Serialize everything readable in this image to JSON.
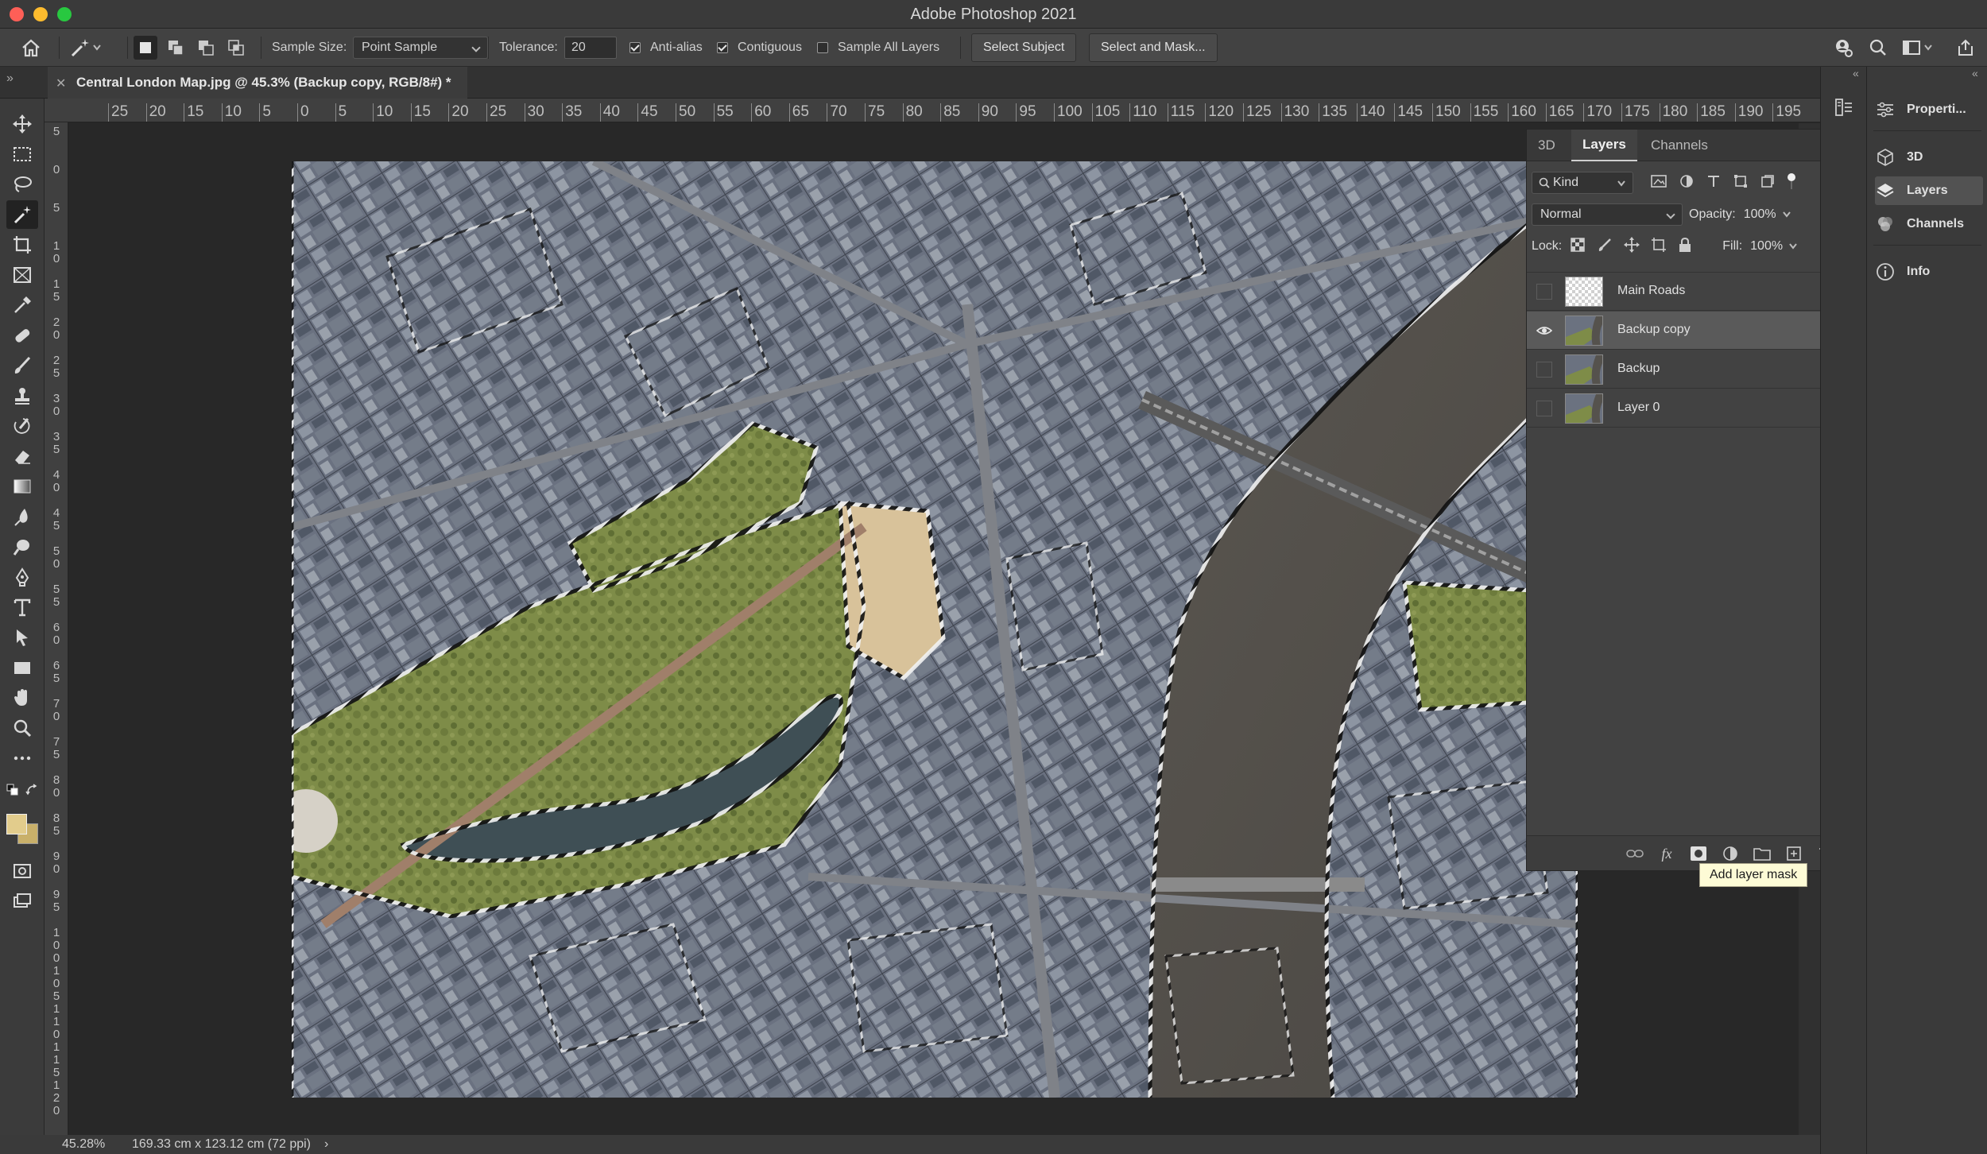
{
  "app": {
    "title": "Adobe Photoshop 2021"
  },
  "options_bar": {
    "sample_size_label": "Sample Size:",
    "sample_size_value": "Point Sample",
    "tolerance_label": "Tolerance:",
    "tolerance_value": "20",
    "anti_alias_label": "Anti-alias",
    "anti_alias_checked": true,
    "contiguous_label": "Contiguous",
    "contiguous_checked": true,
    "sample_all_layers_label": "Sample All Layers",
    "sample_all_layers_checked": false,
    "select_subject_label": "Select Subject",
    "select_and_mask_label": "Select and Mask..."
  },
  "document": {
    "tab_title": "Central London Map.jpg @ 45.3% (Backup copy, RGB/8#) *"
  },
  "rulers": {
    "horizontal_ticks": [
      "25",
      "20",
      "15",
      "10",
      "5",
      "0",
      "5",
      "10",
      "15",
      "20",
      "25",
      "30",
      "35",
      "40",
      "45",
      "50",
      "55",
      "60",
      "65",
      "70",
      "75",
      "80",
      "85",
      "90",
      "95",
      "100",
      "105",
      "110",
      "115",
      "120",
      "125",
      "130",
      "135",
      "140",
      "145",
      "150",
      "155",
      "160",
      "165",
      "170",
      "175",
      "180",
      "185",
      "190",
      "195"
    ],
    "vertical_ticks": [
      "5",
      "0",
      "5",
      "1 0",
      "1 5",
      "2 0",
      "2 5",
      "3 0",
      "3 5",
      "4 0",
      "4 5",
      "5 0",
      "5 5",
      "6 0",
      "6 5",
      "7 0",
      "7 5",
      "8 0",
      "8 5",
      "9 0",
      "9 5",
      "1 0 0",
      "1 0 5",
      "1 1 0",
      "1 1 5",
      "1 2 0"
    ]
  },
  "status_bar": {
    "zoom": "45.28%",
    "doc_size": "169.33 cm x 123.12 cm (72 ppi)",
    "arrow": "›"
  },
  "right_dock": {
    "items": [
      {
        "label": "Properti...",
        "icon": "properties-icon"
      },
      {
        "label": "3D",
        "icon": "cube-icon"
      },
      {
        "label": "Layers",
        "icon": "layers-icon"
      },
      {
        "label": "Channels",
        "icon": "channels-icon"
      },
      {
        "label": "Info",
        "icon": "info-icon"
      }
    ]
  },
  "layers_panel": {
    "tabs": [
      "3D",
      "Layers",
      "Channels"
    ],
    "active_tab": "Layers",
    "filter_kind": "Kind",
    "blend_mode": "Normal",
    "opacity_label": "Opacity:",
    "opacity_value": "100%",
    "lock_label": "Lock:",
    "fill_label": "Fill:",
    "fill_value": "100%",
    "layers": [
      {
        "name": "Main Roads",
        "visible": false,
        "selected": false
      },
      {
        "name": "Backup copy",
        "visible": true,
        "selected": true
      },
      {
        "name": "Backup",
        "visible": false,
        "selected": false
      },
      {
        "name": "Layer 0",
        "visible": false,
        "selected": false
      }
    ],
    "tooltip": "Add layer mask"
  },
  "colors": {
    "foreground": "#e2cc8c",
    "background": "#c9b06a",
    "panel_bg": "#424242",
    "selected_layer": "#5a5a5a"
  }
}
